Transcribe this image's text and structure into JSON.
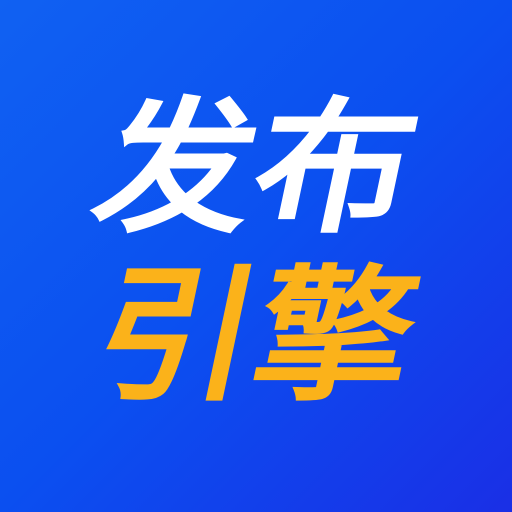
{
  "logo": {
    "line1": "发布",
    "line2": "引擎"
  },
  "colors": {
    "background_start": "#1061f2",
    "background_end": "#1a2fe6",
    "line1_text": "#ffffff",
    "line2_text": "#fbb21a"
  }
}
